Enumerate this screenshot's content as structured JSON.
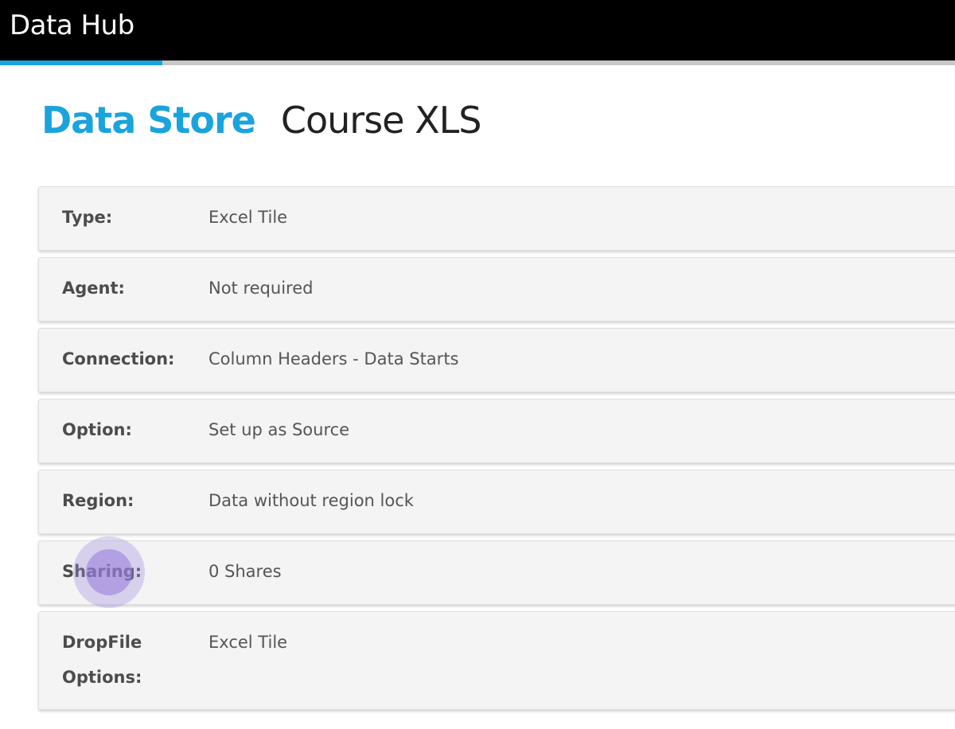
{
  "app": {
    "title": "Data Hub",
    "progress_fraction": 0.17
  },
  "page": {
    "section_title": "Data Store",
    "item_name": "Course XLS"
  },
  "details": [
    {
      "label": "Type:",
      "value": "Excel Tile"
    },
    {
      "label": "Agent:",
      "value": "Not required"
    },
    {
      "label": "Connection:",
      "value": "Column Headers - Data Starts"
    },
    {
      "label": "Option:",
      "value": "Set up as Source"
    },
    {
      "label": "Region:",
      "value": "Data without region lock"
    },
    {
      "label": "Sharing:",
      "value": "0 Shares"
    },
    {
      "label": "DropFile Options:",
      "value": "Excel Tile"
    }
  ],
  "colors": {
    "accent": "#1aa3dc",
    "topbar": "#000000",
    "row_bg": "#f4f4f4"
  }
}
